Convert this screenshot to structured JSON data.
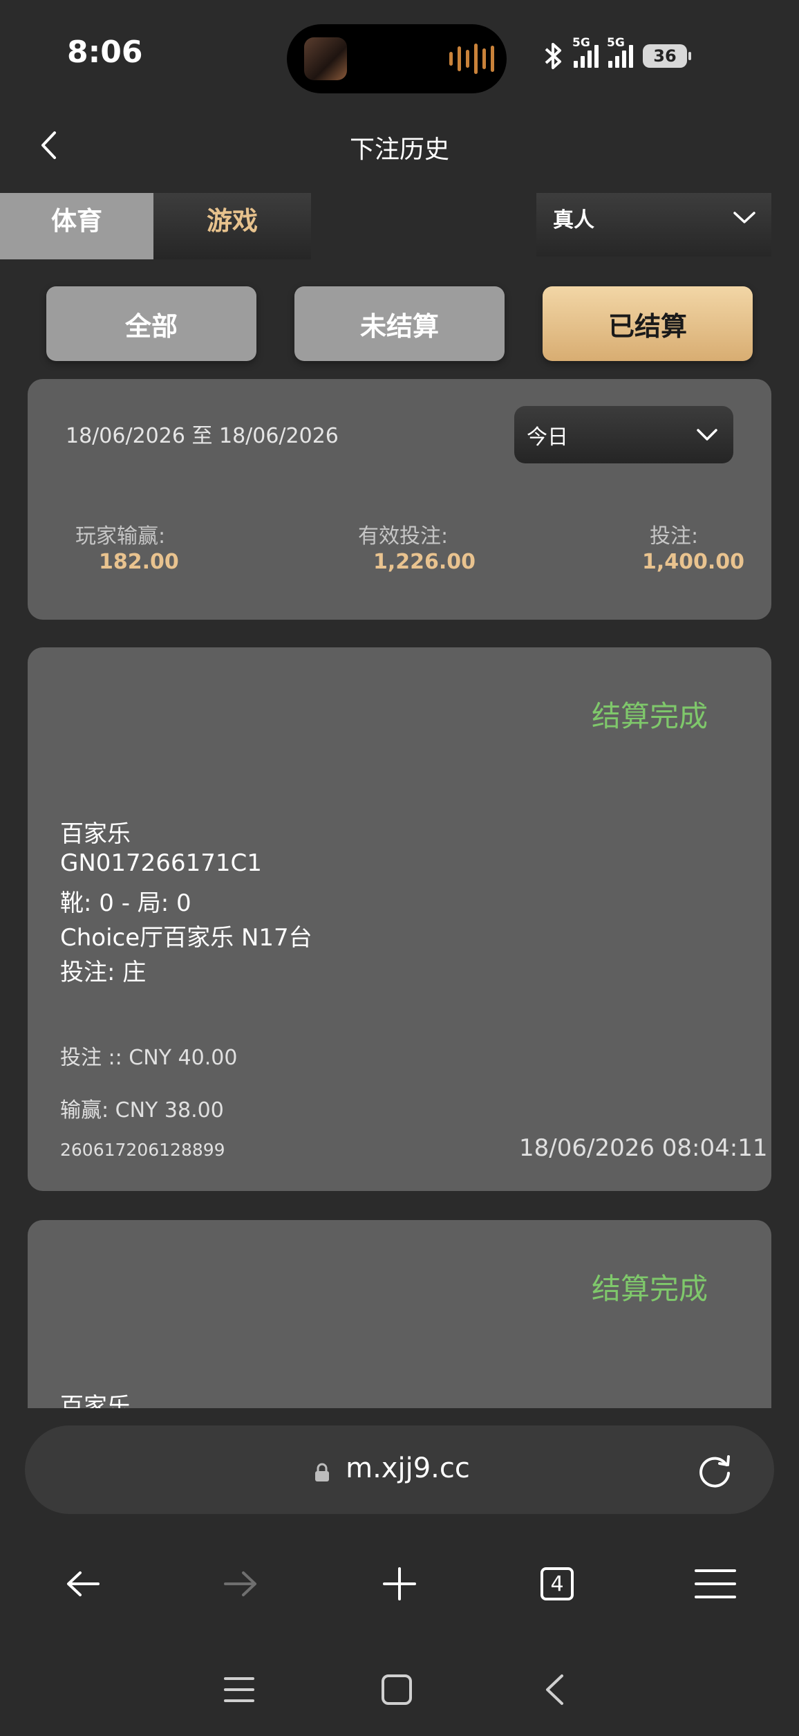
{
  "status_bar": {
    "time": "8:06",
    "network_1": "5G",
    "network_2": "5G",
    "battery": "36"
  },
  "header": {
    "title": "下注历史"
  },
  "tabs": [
    {
      "label": "体育"
    },
    {
      "label": "游戏"
    }
  ],
  "type_select": {
    "value": "真人"
  },
  "filters": [
    {
      "label": "全部"
    },
    {
      "label": "未结算"
    },
    {
      "label": "已结算"
    }
  ],
  "summary": {
    "date_range": "18/06/2026 至 18/06/2026",
    "period": "今日",
    "player_winloss_label": "玩家输赢:",
    "player_winloss_value": "182.00",
    "valid_bet_label": "有效投注:",
    "valid_bet_value": "1,226.00",
    "bet_label": "投注:",
    "bet_value": "1,400.00"
  },
  "bets": [
    {
      "status": "结算完成",
      "game": "百家乐",
      "code": "GN017266171C1",
      "shoe_round": "靴: 0 - 局: 0",
      "table": "Choice厅百家乐 N17台",
      "bet_on": "投注: 庄",
      "stake": "投注 :: CNY  40.00",
      "winloss": "输赢: CNY 38.00",
      "bet_id": "260617206128899",
      "time": "18/06/2026 08:04:11"
    },
    {
      "status": "结算完成",
      "game": "百家乐"
    }
  ],
  "browser": {
    "url": "m.xjj9.cc",
    "tab_count": "4"
  },
  "colors": {
    "accent_gold": "#e9c38f",
    "status_green": "#7fc86b",
    "card_bg": "#5f5f5f",
    "page_bg": "#2b2b2b"
  }
}
